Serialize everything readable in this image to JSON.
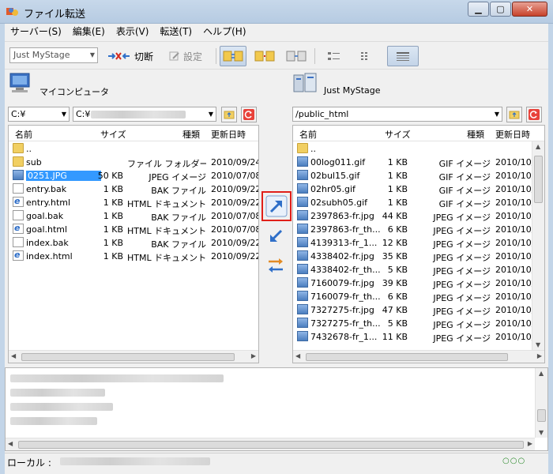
{
  "window": {
    "title": "ファイル転送"
  },
  "menu": [
    "サーバー(S)",
    "編集(E)",
    "表示(V)",
    "転送(T)",
    "ヘルプ(H)"
  ],
  "toolbar": {
    "site_select": "Just MyStage",
    "disconnect_label": "切断",
    "settings_label": "設定"
  },
  "local": {
    "title": "マイコンピュータ",
    "drive": "C:¥",
    "path": "C:¥",
    "columns": [
      "名前",
      "サイズ",
      "種類",
      "更新日時"
    ],
    "files": [
      {
        "name": "..",
        "size": "",
        "type": "",
        "date": "",
        "icon": "folder"
      },
      {
        "name": "sub",
        "size": "",
        "type": "ファイル フォルダー",
        "date": "2010/09/24",
        "icon": "folder"
      },
      {
        "name": "0251.JPG",
        "size": "50 KB",
        "type": "JPEG イメージ",
        "date": "2010/07/08",
        "icon": "image",
        "selected": true
      },
      {
        "name": "entry.bak",
        "size": "1 KB",
        "type": "BAK ファイル",
        "date": "2010/09/22",
        "icon": "file"
      },
      {
        "name": "entry.html",
        "size": "1 KB",
        "type": "HTML ドキュメント",
        "date": "2010/09/22",
        "icon": "html"
      },
      {
        "name": "goal.bak",
        "size": "1 KB",
        "type": "BAK ファイル",
        "date": "2010/07/08",
        "icon": "file"
      },
      {
        "name": "goal.html",
        "size": "1 KB",
        "type": "HTML ドキュメント",
        "date": "2010/07/08",
        "icon": "html"
      },
      {
        "name": "index.bak",
        "size": "1 KB",
        "type": "BAK ファイル",
        "date": "2010/09/22",
        "icon": "file"
      },
      {
        "name": "index.html",
        "size": "1 KB",
        "type": "HTML ドキュメント",
        "date": "2010/09/22",
        "icon": "html"
      }
    ]
  },
  "remote": {
    "title": "Just MyStage",
    "path": "/public_html",
    "columns": [
      "名前",
      "サイズ",
      "種類",
      "更新日時"
    ],
    "files": [
      {
        "name": "..",
        "size": "",
        "type": "",
        "date": "",
        "icon": "folder"
      },
      {
        "name": "00log011.gif",
        "size": "1 KB",
        "type": "GIF イメージ",
        "date": "2010/10/",
        "icon": "image"
      },
      {
        "name": "02bul15.gif",
        "size": "1 KB",
        "type": "GIF イメージ",
        "date": "2010/10/",
        "icon": "image"
      },
      {
        "name": "02hr05.gif",
        "size": "1 KB",
        "type": "GIF イメージ",
        "date": "2010/10/",
        "icon": "image"
      },
      {
        "name": "02subh05.gif",
        "size": "1 KB",
        "type": "GIF イメージ",
        "date": "2010/10/",
        "icon": "image"
      },
      {
        "name": "2397863-fr.jpg",
        "size": "44 KB",
        "type": "JPEG イメージ",
        "date": "2010/10/",
        "icon": "image"
      },
      {
        "name": "2397863-fr_th...",
        "size": "6 KB",
        "type": "JPEG イメージ",
        "date": "2010/10/",
        "icon": "image"
      },
      {
        "name": "4139313-fr_1...",
        "size": "12 KB",
        "type": "JPEG イメージ",
        "date": "2010/10/",
        "icon": "image"
      },
      {
        "name": "4338402-fr.jpg",
        "size": "35 KB",
        "type": "JPEG イメージ",
        "date": "2010/10/",
        "icon": "image"
      },
      {
        "name": "4338402-fr_th...",
        "size": "5 KB",
        "type": "JPEG イメージ",
        "date": "2010/10/",
        "icon": "image"
      },
      {
        "name": "7160079-fr.jpg",
        "size": "39 KB",
        "type": "JPEG イメージ",
        "date": "2010/10/",
        "icon": "image"
      },
      {
        "name": "7160079-fr_th...",
        "size": "6 KB",
        "type": "JPEG イメージ",
        "date": "2010/10/",
        "icon": "image"
      },
      {
        "name": "7327275-fr.jpg",
        "size": "47 KB",
        "type": "JPEG イメージ",
        "date": "2010/10/",
        "icon": "image"
      },
      {
        "name": "7327275-fr_th...",
        "size": "5 KB",
        "type": "JPEG イメージ",
        "date": "2010/10/",
        "icon": "image"
      },
      {
        "name": "7432678-fr_1...",
        "size": "11 KB",
        "type": "JPEG イメージ",
        "date": "2010/10/",
        "icon": "image"
      }
    ]
  },
  "status": {
    "label": "ローカル :"
  },
  "colors": {
    "highlight_border": "#e0201a",
    "selection": "#3399ff"
  }
}
